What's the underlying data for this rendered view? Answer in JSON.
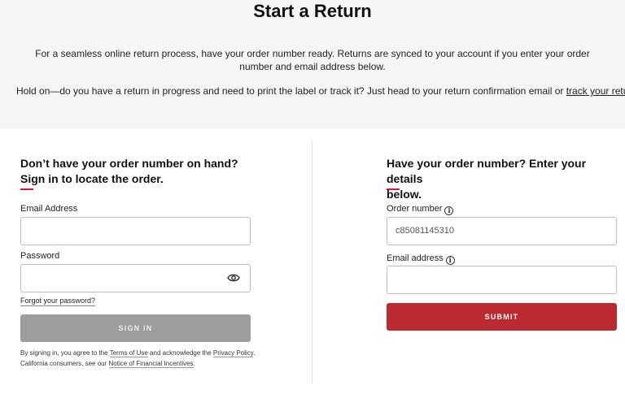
{
  "header": {
    "title": "Start a Return",
    "intro": "For a seamless online return process, have your order number ready. Returns are synced to your account if you enter your order number and email address below.",
    "holdon_text": "Hold on—do you have a return in progress and need to print the label or track it? Just head to your return confirmation email or ",
    "track_link": "track your return",
    "holdon_end": "."
  },
  "signin": {
    "heading_line1": "Don’t have your order number on hand?",
    "heading_line2": "Sign in to locate the order.",
    "email_label": "Email Address",
    "email_value": "",
    "password_label": "Password",
    "password_value": "",
    "forgot_link": "Forgot your password?",
    "button_label": "SIGN IN",
    "legal_1": "By signing in, you agree to the ",
    "terms_link": "Terms of Use",
    "legal_2": " and acknowledge the ",
    "privacy_link": "Privacy Policy",
    "legal_3": ". California consumers, see our ",
    "notice_link": "Notice of Financial Incentives",
    "legal_4": "."
  },
  "order": {
    "heading_line1": "Have your order number? Enter your details",
    "heading_line2": "below.",
    "order_label": "Order number",
    "order_value": "c85081145310",
    "email_label": "Email address",
    "email_value": "",
    "button_label": "SUBMIT"
  },
  "colors": {
    "accent": "#c4202f",
    "submit_bg": "#bb2a31",
    "signin_disabled_bg": "#9d9d9f",
    "top_band_bg": "#f5f5f5"
  },
  "icons": {
    "info": "info-icon",
    "password_toggle": "eye-icon"
  }
}
